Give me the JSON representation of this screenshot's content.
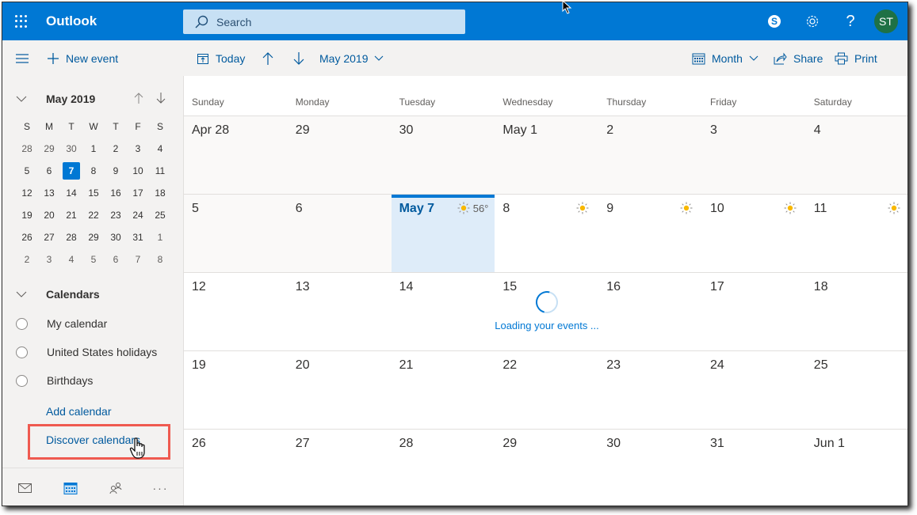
{
  "app": {
    "title": "Outlook",
    "search_placeholder": "Search",
    "avatar_initials": "ST",
    "accent": "#0078d4"
  },
  "topbar_icons": [
    "skype-icon",
    "gear-icon",
    "help-icon"
  ],
  "toolbar": {
    "new_event": "New event",
    "today": "Today",
    "month_label": "May 2019",
    "view": "Month",
    "share": "Share",
    "print": "Print"
  },
  "mini_calendar": {
    "title": "May 2019",
    "weekday_initials": [
      "S",
      "M",
      "T",
      "W",
      "T",
      "F",
      "S"
    ],
    "selected": "7",
    "weeks": [
      [
        [
          "28",
          1
        ],
        [
          "29",
          1
        ],
        [
          "30",
          1
        ],
        [
          "1",
          0
        ],
        [
          "2",
          0
        ],
        [
          "3",
          0
        ],
        [
          "4",
          0
        ]
      ],
      [
        [
          "5",
          0
        ],
        [
          "6",
          0
        ],
        [
          "7",
          0
        ],
        [
          "8",
          0
        ],
        [
          "9",
          0
        ],
        [
          "10",
          0
        ],
        [
          "11",
          0
        ]
      ],
      [
        [
          "12",
          0
        ],
        [
          "13",
          0
        ],
        [
          "14",
          0
        ],
        [
          "15",
          0
        ],
        [
          "16",
          0
        ],
        [
          "17",
          0
        ],
        [
          "18",
          0
        ]
      ],
      [
        [
          "19",
          0
        ],
        [
          "20",
          0
        ],
        [
          "21",
          0
        ],
        [
          "22",
          0
        ],
        [
          "23",
          0
        ],
        [
          "24",
          0
        ],
        [
          "25",
          0
        ]
      ],
      [
        [
          "26",
          0
        ],
        [
          "27",
          0
        ],
        [
          "28",
          0
        ],
        [
          "29",
          0
        ],
        [
          "30",
          0
        ],
        [
          "31",
          0
        ],
        [
          "1",
          1
        ]
      ],
      [
        [
          "2",
          1
        ],
        [
          "3",
          1
        ],
        [
          "4",
          1
        ],
        [
          "5",
          1
        ],
        [
          "6",
          1
        ],
        [
          "7",
          1
        ],
        [
          "8",
          1
        ]
      ]
    ]
  },
  "calendars": {
    "heading": "Calendars",
    "items": [
      "My calendar",
      "United States holidays",
      "Birthdays"
    ],
    "add_link": "Add calendar",
    "discover_link": "Discover calendars"
  },
  "bottom_nav": [
    "mail-icon",
    "calendar-icon",
    "people-icon",
    "more-icon"
  ],
  "month_view": {
    "weekdays": [
      "Sunday",
      "Monday",
      "Tuesday",
      "Wednesday",
      "Thursday",
      "Friday",
      "Saturday"
    ],
    "weeks": [
      [
        {
          "label": "Apr 28",
          "past": true
        },
        {
          "label": "29",
          "past": true
        },
        {
          "label": "30",
          "past": true
        },
        {
          "label": "May 1",
          "past": true
        },
        {
          "label": "2",
          "past": true
        },
        {
          "label": "3",
          "past": true
        },
        {
          "label": "4",
          "past": true
        }
      ],
      [
        {
          "label": "5",
          "past": true
        },
        {
          "label": "6",
          "past": true
        },
        {
          "label": "May 7",
          "today": true,
          "weather": "sun",
          "temp": "56°"
        },
        {
          "label": "8",
          "weather": "sun"
        },
        {
          "label": "9",
          "weather": "sun"
        },
        {
          "label": "10",
          "weather": "sun"
        },
        {
          "label": "11",
          "weather": "sun"
        }
      ],
      [
        {
          "label": "12"
        },
        {
          "label": "13"
        },
        {
          "label": "14"
        },
        {
          "label": "15"
        },
        {
          "label": "16"
        },
        {
          "label": "17"
        },
        {
          "label": "18"
        }
      ],
      [
        {
          "label": "19"
        },
        {
          "label": "20"
        },
        {
          "label": "21"
        },
        {
          "label": "22"
        },
        {
          "label": "23"
        },
        {
          "label": "24"
        },
        {
          "label": "25"
        }
      ],
      [
        {
          "label": "26"
        },
        {
          "label": "27"
        },
        {
          "label": "28"
        },
        {
          "label": "29"
        },
        {
          "label": "30"
        },
        {
          "label": "31"
        },
        {
          "label": "Jun 1"
        }
      ]
    ],
    "loading_text": "Loading your events ..."
  }
}
